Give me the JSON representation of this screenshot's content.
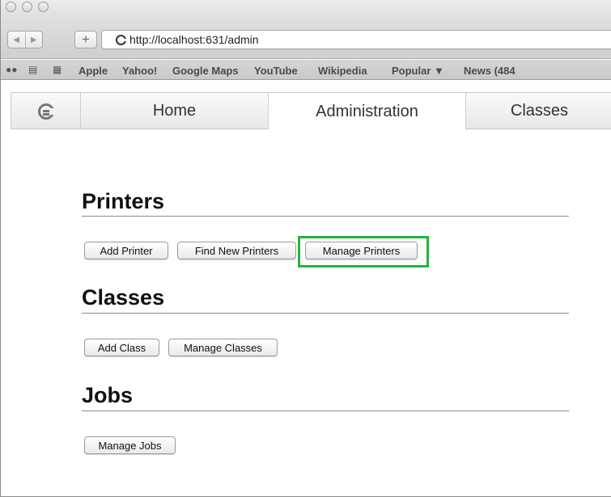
{
  "browser": {
    "url": "http://localhost:631/admin",
    "bookmarks": [
      "Apple",
      "Yahoo!",
      "Google Maps",
      "YouTube",
      "Wikipedia",
      "Popular ▼",
      "News (484"
    ],
    "icons": {
      "reading_list": "reading-list-icon",
      "bookmarks": "bookmarks-book-icon",
      "top_sites": "top-sites-grid-icon"
    }
  },
  "nav": {
    "tabs": [
      "Home",
      "Administration",
      "Classes"
    ],
    "active": "Administration"
  },
  "sections": {
    "printers": {
      "title": "Printers",
      "buttons": [
        "Add Printer",
        "Find New Printers",
        "Manage Printers"
      ]
    },
    "classes": {
      "title": "Classes",
      "buttons": [
        "Add Class",
        "Manage Classes"
      ]
    },
    "jobs": {
      "title": "Jobs",
      "buttons": [
        "Manage Jobs"
      ]
    }
  },
  "highlight": {
    "target": "Manage Printers",
    "color": "#25b33d"
  }
}
